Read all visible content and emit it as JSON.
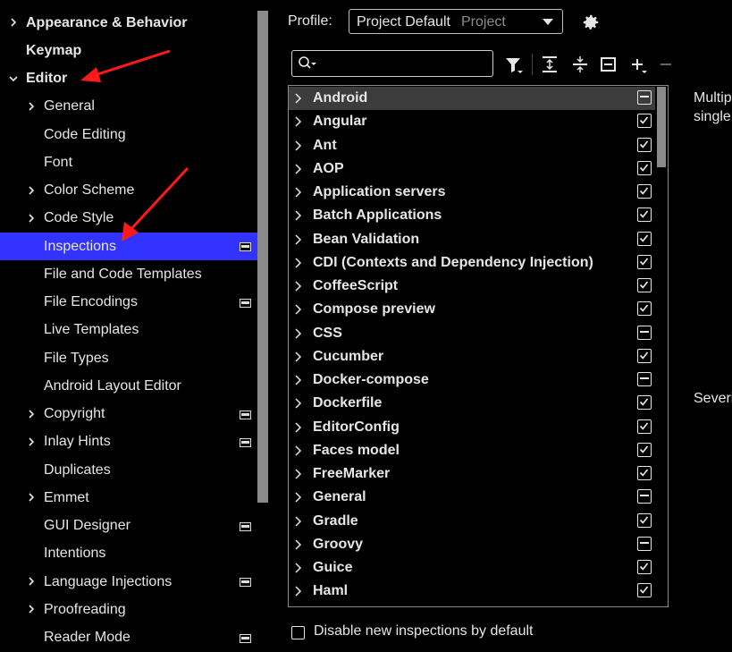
{
  "sidebar": {
    "items": [
      {
        "label": "Appearance & Behavior",
        "bold": true,
        "expandable": true,
        "expanded": false,
        "indent": 0,
        "project": false
      },
      {
        "label": "Keymap",
        "bold": true,
        "expandable": false,
        "expanded": false,
        "indent": 0,
        "project": false
      },
      {
        "label": "Editor",
        "bold": true,
        "expandable": true,
        "expanded": true,
        "indent": 0,
        "project": false
      },
      {
        "label": "General",
        "bold": false,
        "expandable": true,
        "expanded": false,
        "indent": 1,
        "project": false
      },
      {
        "label": "Code Editing",
        "bold": false,
        "expandable": false,
        "expanded": false,
        "indent": 1,
        "project": false
      },
      {
        "label": "Font",
        "bold": false,
        "expandable": false,
        "expanded": false,
        "indent": 1,
        "project": false
      },
      {
        "label": "Color Scheme",
        "bold": false,
        "expandable": true,
        "expanded": false,
        "indent": 1,
        "project": false
      },
      {
        "label": "Code Style",
        "bold": false,
        "expandable": true,
        "expanded": false,
        "indent": 1,
        "project": false
      },
      {
        "label": "Inspections",
        "bold": false,
        "expandable": false,
        "expanded": false,
        "indent": 1,
        "project": true,
        "selected": true
      },
      {
        "label": "File and Code Templates",
        "bold": false,
        "expandable": false,
        "expanded": false,
        "indent": 1,
        "project": false
      },
      {
        "label": "File Encodings",
        "bold": false,
        "expandable": false,
        "expanded": false,
        "indent": 1,
        "project": true
      },
      {
        "label": "Live Templates",
        "bold": false,
        "expandable": false,
        "expanded": false,
        "indent": 1,
        "project": false
      },
      {
        "label": "File Types",
        "bold": false,
        "expandable": false,
        "expanded": false,
        "indent": 1,
        "project": false
      },
      {
        "label": "Android Layout Editor",
        "bold": false,
        "expandable": false,
        "expanded": false,
        "indent": 1,
        "project": false
      },
      {
        "label": "Copyright",
        "bold": false,
        "expandable": true,
        "expanded": false,
        "indent": 1,
        "project": true
      },
      {
        "label": "Inlay Hints",
        "bold": false,
        "expandable": true,
        "expanded": false,
        "indent": 1,
        "project": true
      },
      {
        "label": "Duplicates",
        "bold": false,
        "expandable": false,
        "expanded": false,
        "indent": 1,
        "project": false
      },
      {
        "label": "Emmet",
        "bold": false,
        "expandable": true,
        "expanded": false,
        "indent": 1,
        "project": false
      },
      {
        "label": "GUI Designer",
        "bold": false,
        "expandable": false,
        "expanded": false,
        "indent": 1,
        "project": true
      },
      {
        "label": "Intentions",
        "bold": false,
        "expandable": false,
        "expanded": false,
        "indent": 1,
        "project": false
      },
      {
        "label": "Language Injections",
        "bold": false,
        "expandable": true,
        "expanded": false,
        "indent": 1,
        "project": true
      },
      {
        "label": "Proofreading",
        "bold": false,
        "expandable": true,
        "expanded": false,
        "indent": 1,
        "project": false
      },
      {
        "label": "Reader Mode",
        "bold": false,
        "expandable": false,
        "expanded": false,
        "indent": 1,
        "project": true
      }
    ]
  },
  "profile": {
    "label": "Profile:",
    "value": "Project Default",
    "scope": "Project"
  },
  "search": {
    "placeholder": "",
    "value": ""
  },
  "toolbar": {
    "icons": [
      "filter-icon",
      "expand-all-icon",
      "collapse-all-icon",
      "collapse-group-icon",
      "add-icon",
      "remove-icon"
    ]
  },
  "inspections": [
    {
      "label": "Android",
      "state": "partial"
    },
    {
      "label": "Angular",
      "state": "checked"
    },
    {
      "label": "Ant",
      "state": "checked"
    },
    {
      "label": "AOP",
      "state": "checked"
    },
    {
      "label": "Application servers",
      "state": "checked"
    },
    {
      "label": "Batch Applications",
      "state": "checked"
    },
    {
      "label": "Bean Validation",
      "state": "checked"
    },
    {
      "label": "CDI (Contexts and Dependency Injection)",
      "state": "checked"
    },
    {
      "label": "CoffeeScript",
      "state": "checked"
    },
    {
      "label": "Compose preview",
      "state": "checked"
    },
    {
      "label": "CSS",
      "state": "partial"
    },
    {
      "label": "Cucumber",
      "state": "checked"
    },
    {
      "label": "Docker-compose",
      "state": "partial"
    },
    {
      "label": "Dockerfile",
      "state": "checked"
    },
    {
      "label": "EditorConfig",
      "state": "checked"
    },
    {
      "label": "Faces model",
      "state": "checked"
    },
    {
      "label": "FreeMarker",
      "state": "checked"
    },
    {
      "label": "General",
      "state": "partial"
    },
    {
      "label": "Gradle",
      "state": "checked"
    },
    {
      "label": "Groovy",
      "state": "partial"
    },
    {
      "label": "Guice",
      "state": "checked"
    },
    {
      "label": "Haml",
      "state": "checked"
    }
  ],
  "description": {
    "line1": "Multip",
    "line2": "single",
    "severity": "Severi"
  },
  "footer": {
    "disable_label": "Disable new inspections by default"
  },
  "colors": {
    "selection": "#3333ff",
    "arrow": "#ff1a1a"
  }
}
